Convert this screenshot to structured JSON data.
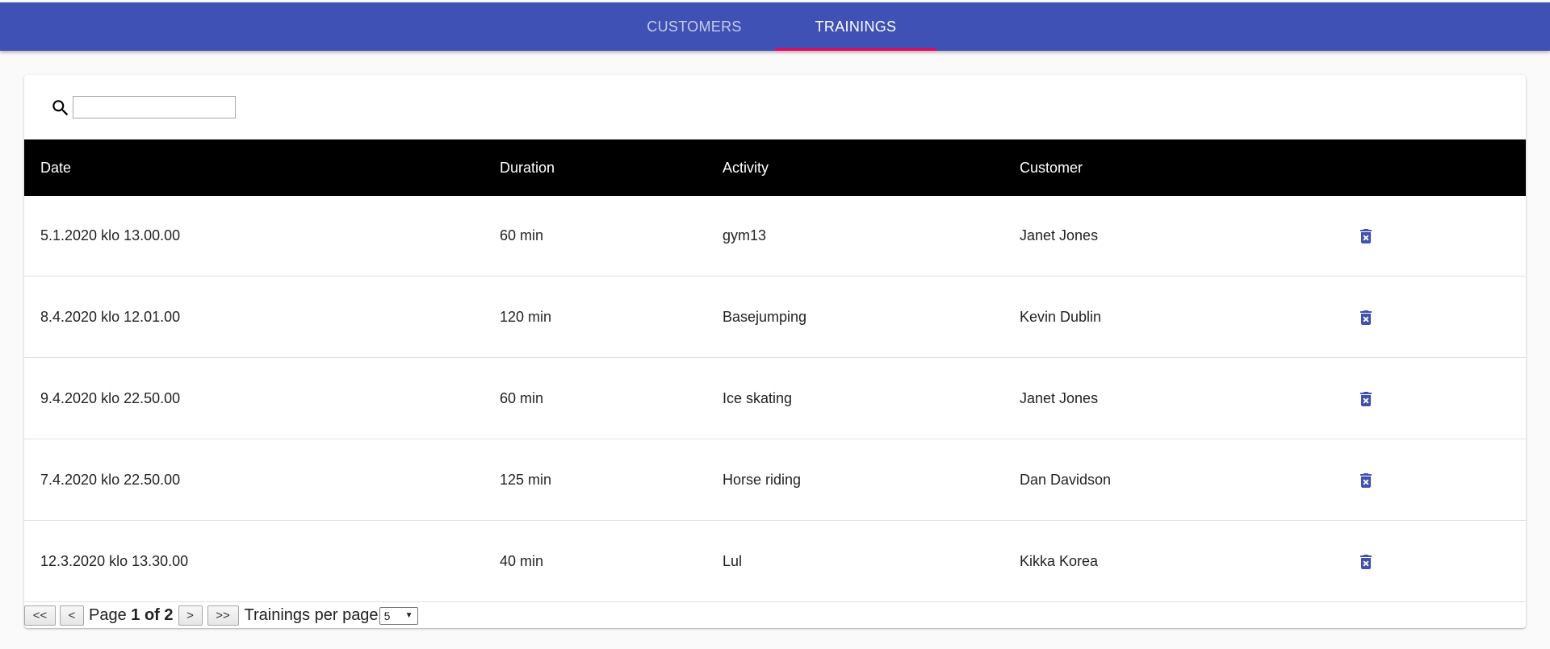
{
  "tabs": {
    "customers_label": "CUSTOMERS",
    "trainings_label": "TRAININGS",
    "active": "trainings"
  },
  "search": {
    "icon": "search-icon",
    "value": "",
    "placeholder": ""
  },
  "table": {
    "headers": {
      "date": "Date",
      "duration": "Duration",
      "activity": "Activity",
      "customer": "Customer"
    },
    "rows": [
      {
        "date": "5.1.2020 klo 13.00.00",
        "duration": "60 min",
        "activity": "gym13",
        "customer": "Janet Jones",
        "action_icon": "delete-icon"
      },
      {
        "date": "8.4.2020 klo 12.01.00",
        "duration": "120 min",
        "activity": "Basejumping",
        "customer": "Kevin Dublin",
        "action_icon": "delete-icon"
      },
      {
        "date": "9.4.2020 klo 22.50.00",
        "duration": "60 min",
        "activity": "Ice skating",
        "customer": "Janet Jones",
        "action_icon": "delete-icon"
      },
      {
        "date": "7.4.2020 klo 22.50.00",
        "duration": "125 min",
        "activity": "Horse riding",
        "customer": "Dan Davidson",
        "action_icon": "delete-icon"
      },
      {
        "date": "12.3.2020 klo 13.30.00",
        "duration": "40 min",
        "activity": "Lul",
        "customer": "Kikka Korea",
        "action_icon": "delete-icon"
      }
    ]
  },
  "pagination": {
    "first_label": "<<",
    "prev_label": "<",
    "page_prefix": "Page",
    "page_current": "1 of 2",
    "next_label": ">",
    "last_label": ">>",
    "per_page_label": "Trainings per page",
    "per_page_value": "5"
  },
  "colors": {
    "appbar": "#3f51b5",
    "tab_indicator": "#f50057",
    "header_bg": "#000000",
    "delete_icon": "#3f51b5"
  }
}
